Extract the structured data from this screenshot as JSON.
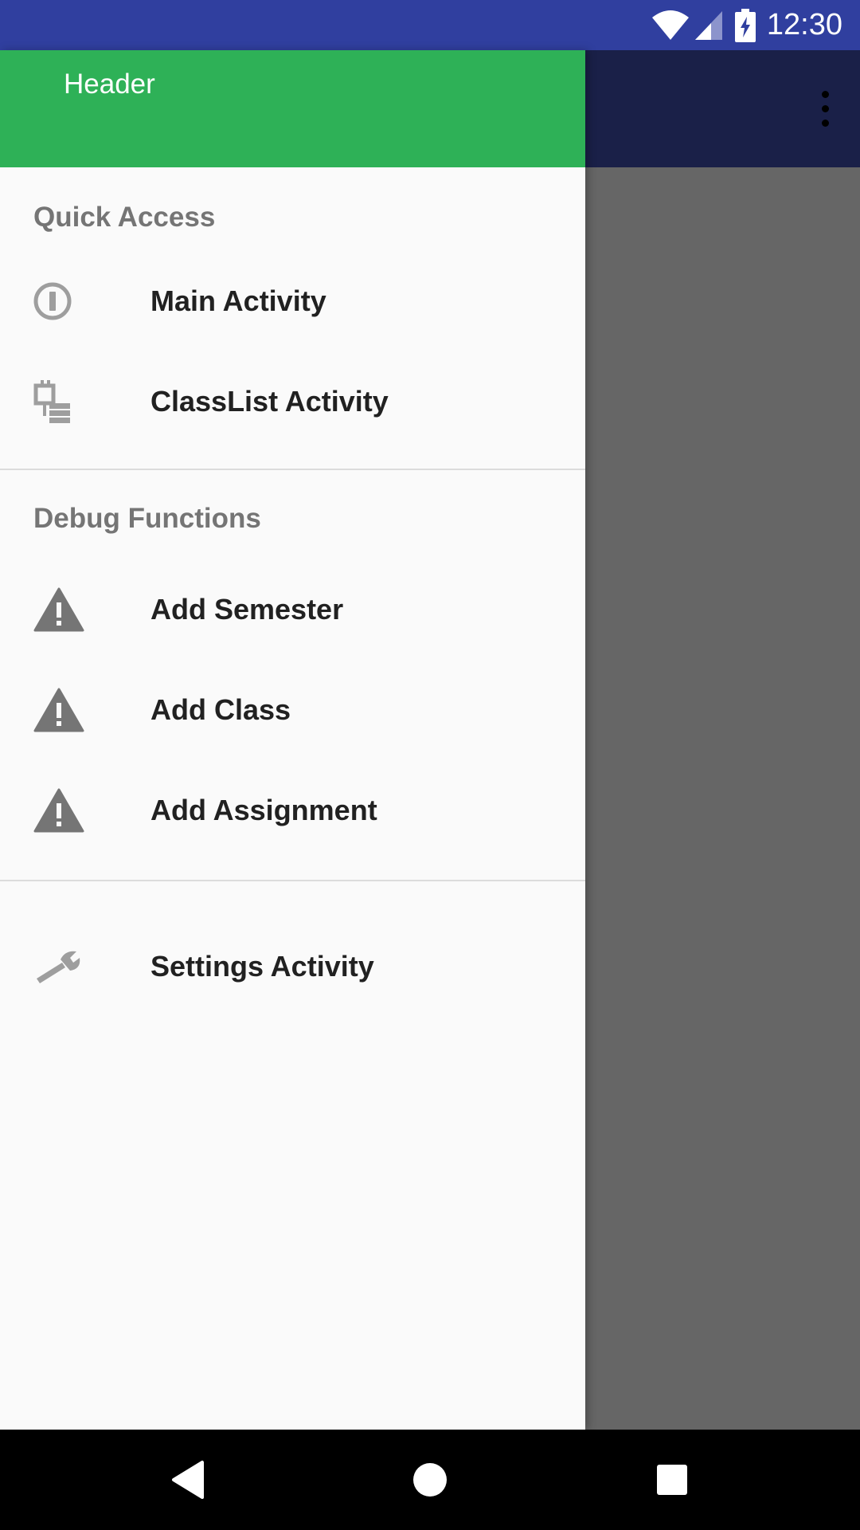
{
  "status_bar": {
    "time": "12:30",
    "icons": [
      "wifi-icon",
      "cellular-signal-icon",
      "battery-charging-icon"
    ]
  },
  "toolbar": {
    "overflow_icon": "more-vert-icon"
  },
  "drawer": {
    "header_title": "Header",
    "header_color": "#2eb157",
    "sections": {
      "quick_access": {
        "title": "Quick Access",
        "items": [
          {
            "label": "Main Activity",
            "icon": "info-circle-icon"
          },
          {
            "label": "ClassList Activity",
            "icon": "class-list-icon"
          }
        ]
      },
      "debug_functions": {
        "title": "Debug Functions",
        "items": [
          {
            "label": "Add Semester",
            "icon": "warning-icon"
          },
          {
            "label": "Add Class",
            "icon": "warning-icon"
          },
          {
            "label": "Add Assignment",
            "icon": "warning-icon"
          }
        ]
      },
      "other": {
        "items": [
          {
            "label": "Settings Activity",
            "icon": "wrench-icon"
          }
        ]
      }
    }
  },
  "nav_bar": {
    "buttons": [
      "back-icon",
      "home-icon",
      "recents-icon"
    ]
  },
  "colors": {
    "status_bar": "#303f9f",
    "toolbar": "#1a2048",
    "scrim": "#666666",
    "icon_gray": "#757575"
  }
}
